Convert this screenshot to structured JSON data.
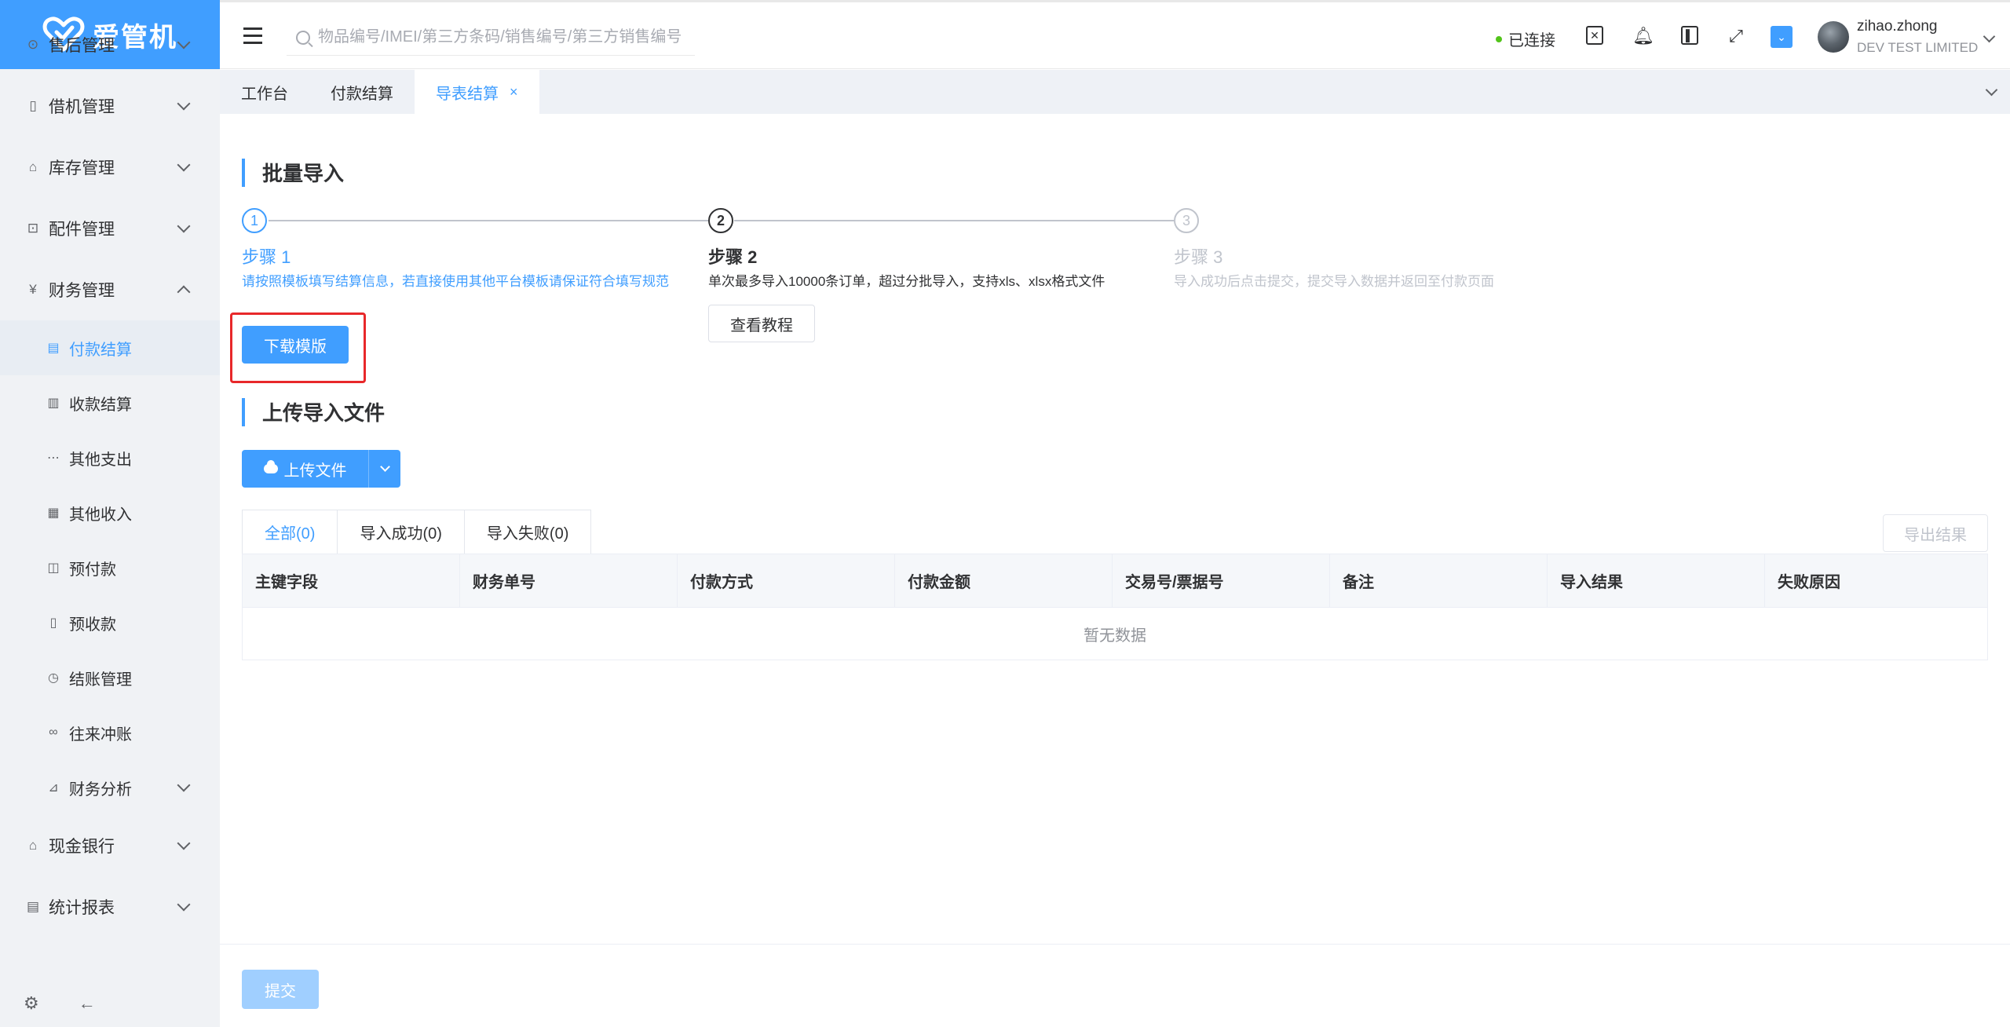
{
  "app": {
    "logo_text": "爱管机",
    "accent_color": "#409eff"
  },
  "sidebar": {
    "menu": [
      {
        "label": "售后管理",
        "icon": "after-sales-icon",
        "expanded": false
      },
      {
        "label": "借机管理",
        "icon": "phone-icon",
        "expanded": false
      },
      {
        "label": "库存管理",
        "icon": "warehouse-icon",
        "expanded": false
      },
      {
        "label": "配件管理",
        "icon": "parts-icon",
        "expanded": false
      },
      {
        "label": "财务管理",
        "icon": "yen-icon",
        "expanded": true
      }
    ],
    "finance_sub": [
      {
        "label": "付款结算",
        "icon": "payment-icon",
        "active": true
      },
      {
        "label": "收款结算",
        "icon": "receipt-icon",
        "active": false
      },
      {
        "label": "其他支出",
        "icon": "ellipsis-icon",
        "active": false
      },
      {
        "label": "其他收入",
        "icon": "income-icon",
        "active": false
      },
      {
        "label": "预付款",
        "icon": "prepay-icon",
        "active": false
      },
      {
        "label": "预收款",
        "icon": "prereceive-icon",
        "active": false
      },
      {
        "label": "结账管理",
        "icon": "history-icon",
        "active": false
      },
      {
        "label": "往来冲账",
        "icon": "link-icon",
        "active": false
      },
      {
        "label": "财务分析",
        "icon": "chart-icon",
        "active": false,
        "has_children": true
      }
    ],
    "menu_after": [
      {
        "label": "现金银行",
        "icon": "bank-icon"
      },
      {
        "label": "统计报表",
        "icon": "report-icon"
      }
    ]
  },
  "header": {
    "search_placeholder": "物品编号/IMEI/第三方条码/销售编号/第三方销售编号",
    "connection_status": "已连接",
    "user_name": "zihao.zhong",
    "company": "DEV TEST LIMITED"
  },
  "tabs": [
    {
      "label": "工作台",
      "active": false
    },
    {
      "label": "付款结算",
      "active": false
    },
    {
      "label": "导表结算",
      "active": true,
      "closable": true
    }
  ],
  "batch_import": {
    "title": "批量导入",
    "steps": [
      {
        "number": "1",
        "title": "步骤 1",
        "desc": "请按照模板填写结算信息，若直接使用其他平台模板请保证符合填写规范",
        "status": "process"
      },
      {
        "number": "2",
        "title": "步骤 2",
        "desc": "单次最多导入10000条订单，超过分批导入，支持xls、xlsx格式文件",
        "status": "current"
      },
      {
        "number": "3",
        "title": "步骤 3",
        "desc": "导入成功后点击提交，提交导入数据并返回至付款页面",
        "status": "wait"
      }
    ],
    "download_label": "下载模版",
    "tutorial_label": "查看教程"
  },
  "upload": {
    "title": "上传导入文件",
    "upload_label": "上传文件"
  },
  "result": {
    "tabs": [
      "全部(0)",
      "导入成功(0)",
      "导入失败(0)"
    ],
    "export_label": "导出结果",
    "columns": [
      "主键字段",
      "财务单号",
      "付款方式",
      "付款金额",
      "交易号/票据号",
      "备注",
      "导入结果",
      "失败原因"
    ],
    "empty_text": "暂无数据"
  },
  "footer": {
    "submit_label": "提交"
  }
}
